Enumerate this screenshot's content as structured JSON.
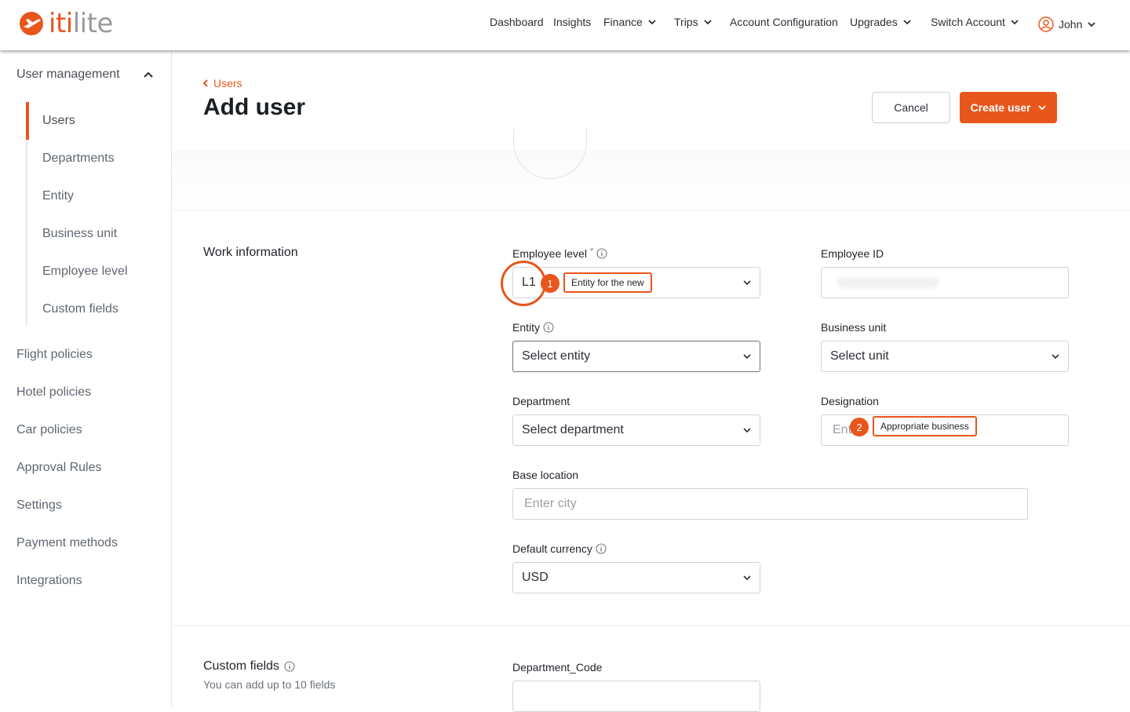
{
  "brand": {
    "logo_mark": "✈",
    "name_accent": "iti",
    "name_rest": "lite"
  },
  "topnav": {
    "dashboard": "Dashboard",
    "insights": "Insights",
    "finance": "Finance",
    "trips": "Trips",
    "account_configuration": "Account Configuration",
    "upgrades": "Upgrades",
    "switch_account": "Switch Account",
    "user": "John"
  },
  "sidebar": {
    "header": "User management",
    "sub_items": [
      "Users",
      "Departments",
      "Entity",
      "Business unit",
      "Employee level",
      "Custom fields"
    ],
    "items": [
      "Flight policies",
      "Hotel policies",
      "Car policies",
      "Approval Rules",
      "Settings",
      "Payment methods",
      "Integrations"
    ]
  },
  "page": {
    "back_label": "Users",
    "title": "Add user",
    "cancel_label": "Cancel",
    "create_label": "Create user"
  },
  "work_info": {
    "section_title": "Work information",
    "employee_level": {
      "label": "Employee level",
      "required_mark": "*",
      "value": "L1"
    },
    "employee_id": {
      "label": "Employee ID"
    },
    "entity": {
      "label": "Entity",
      "value": "Select entity"
    },
    "business_unit": {
      "label": "Business unit",
      "value": "Select unit"
    },
    "department": {
      "label": "Department",
      "value": "Select department"
    },
    "designation": {
      "label": "Designation",
      "placeholder": "Ent"
    },
    "base_location": {
      "label": "Base location",
      "placeholder": "Enter city"
    },
    "default_currency": {
      "label": "Default currency",
      "value": "USD"
    }
  },
  "custom_fields": {
    "section_title": "Custom fields",
    "hint": "You can add up to 10 fields",
    "department_code_label": "Department_Code"
  },
  "annotations": {
    "step1": {
      "number": "1",
      "text": "Entity for the new"
    },
    "step2": {
      "number": "2",
      "text": "Appropriate business"
    }
  },
  "colors": {
    "accent": "#e8561c",
    "text": "#1f2329",
    "muted": "#5f6670"
  }
}
